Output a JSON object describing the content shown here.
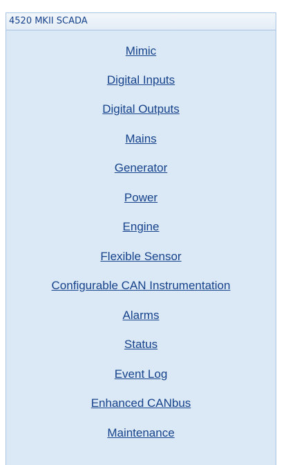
{
  "panel": {
    "title": "4520 MKII SCADA"
  },
  "nav": {
    "items": [
      {
        "label": "Mimic"
      },
      {
        "label": "Digital Inputs"
      },
      {
        "label": "Digital Outputs"
      },
      {
        "label": "Mains"
      },
      {
        "label": "Generator"
      },
      {
        "label": "Power"
      },
      {
        "label": "Engine"
      },
      {
        "label": "Flexible Sensor"
      },
      {
        "label": "Configurable CAN Instrumentation"
      },
      {
        "label": "Alarms"
      },
      {
        "label": "Status"
      },
      {
        "label": "Event Log"
      },
      {
        "label": "Enhanced CANbus"
      },
      {
        "label": "Maintenance"
      }
    ]
  }
}
